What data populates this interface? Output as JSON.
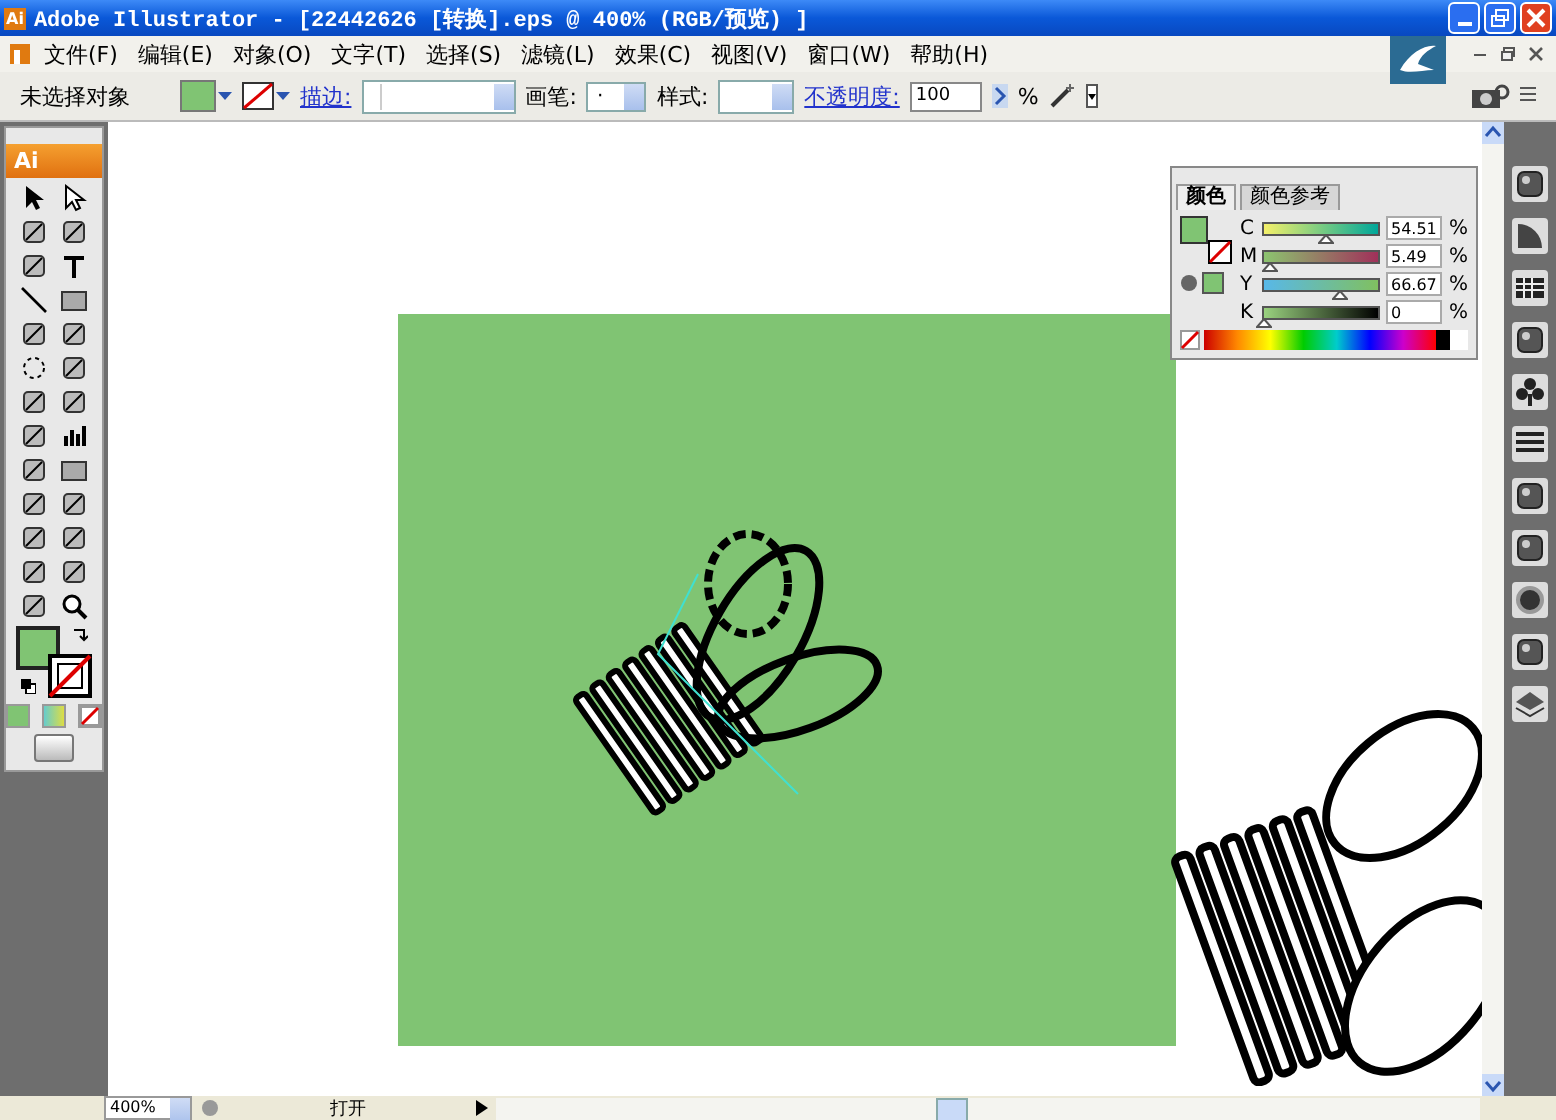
{
  "window": {
    "app_icon": "Ai",
    "title": "Adobe Illustrator - [22442626 [转换].eps @ 400% (RGB/预览) ]"
  },
  "menu": [
    "文件(F)",
    "编辑(E)",
    "对象(O)",
    "文字(T)",
    "选择(S)",
    "滤镜(L)",
    "效果(C)",
    "视图(V)",
    "窗口(W)",
    "帮助(H)"
  ],
  "control_bar": {
    "selection": "未选择对象",
    "stroke_label": "描边:",
    "brush_label": "画笔:",
    "brush_value": "·",
    "style_label": "样式:",
    "opacity_label": "不透明度:",
    "opacity_value": "100",
    "percent": "%"
  },
  "toolbox": {
    "logo": "Ai"
  },
  "color_panel": {
    "tabs": [
      {
        "label": "颜色",
        "selected": true
      },
      {
        "label": "颜色参考",
        "selected": false
      }
    ],
    "channels": [
      {
        "name": "C",
        "value": "54.51",
        "level": 0.5451,
        "unit": "%"
      },
      {
        "name": "M",
        "value": "5.49",
        "level": 0.0549,
        "unit": "%"
      },
      {
        "name": "Y",
        "value": "66.67",
        "level": 0.6667,
        "unit": "%"
      },
      {
        "name": "K",
        "value": "0",
        "level": 0,
        "unit": "%"
      }
    ]
  },
  "status_bar": {
    "zoom": "400%",
    "status": "打开"
  }
}
